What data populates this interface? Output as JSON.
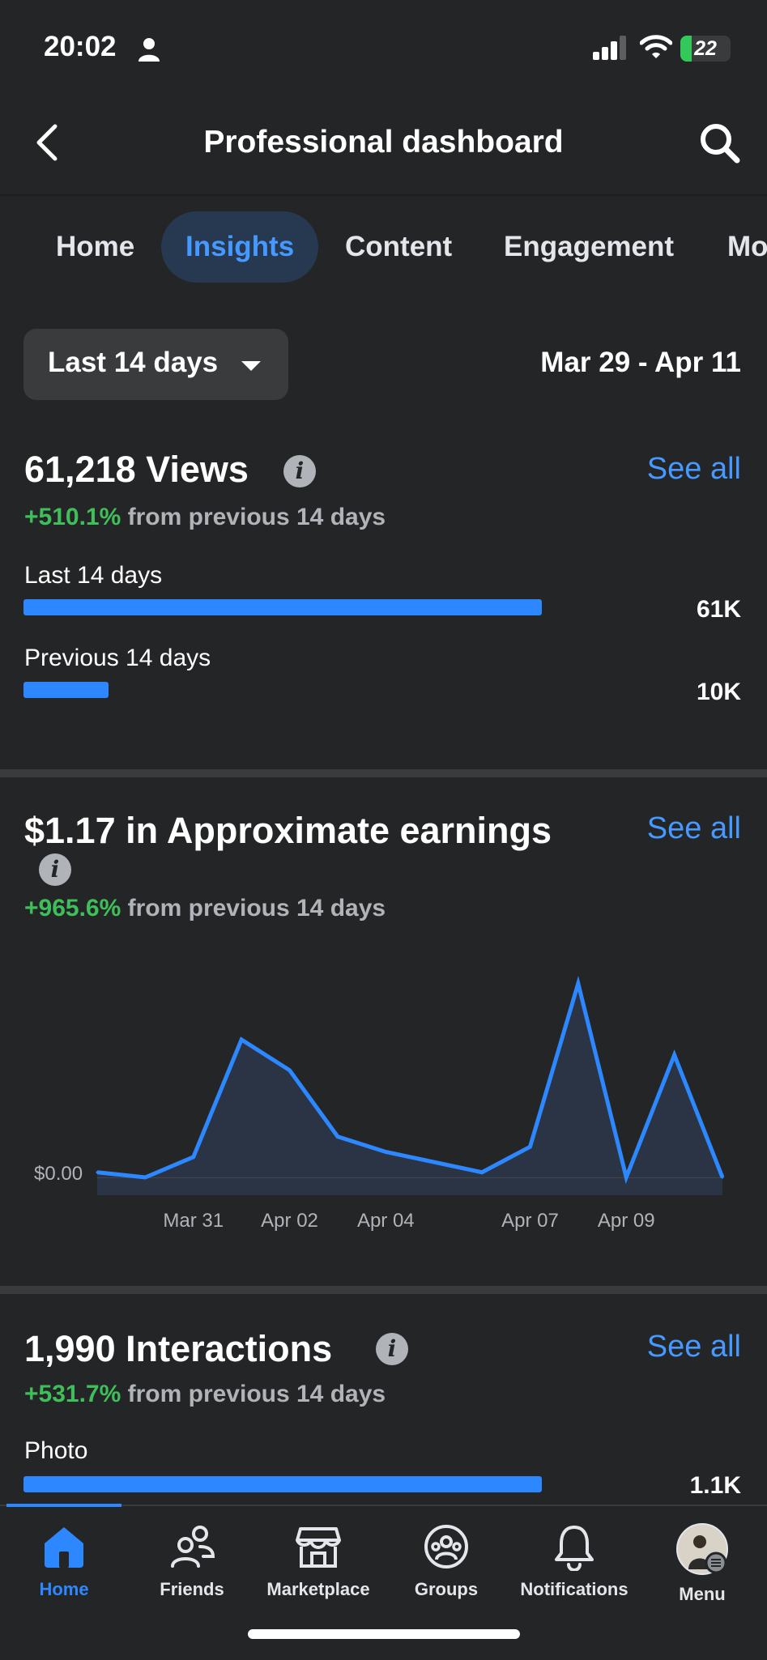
{
  "status_bar": {
    "time": "20:02",
    "battery": "22",
    "battery_level": 0.22
  },
  "header": {
    "title": "Professional dashboard"
  },
  "tabs": [
    {
      "label": "Home",
      "active": false
    },
    {
      "label": "Insights",
      "active": true
    },
    {
      "label": "Content",
      "active": false
    },
    {
      "label": "Engagement",
      "active": false
    },
    {
      "label": "Mo",
      "active": false
    }
  ],
  "filter": {
    "range": "Last 14 days",
    "dates": "Mar 29 - Apr 11"
  },
  "views": {
    "title": "61,218 Views",
    "see_all": "See all",
    "change_pct": "+510.1%",
    "change_text": " from previous 14 days",
    "bars": [
      {
        "label": "Last 14 days",
        "value": "61K",
        "fraction": 1.0
      },
      {
        "label": "Previous 14 days",
        "value": "10K",
        "fraction": 0.164
      }
    ]
  },
  "earnings": {
    "title": "$1.17 in Approximate earnings",
    "see_all": "See all",
    "change_pct": "+965.6%",
    "change_text": " from previous 14 days"
  },
  "chart_data": {
    "type": "area",
    "x": [
      "Mar 29",
      "Mar 30",
      "Mar 31",
      "Apr 01",
      "Apr 02",
      "Apr 03",
      "Apr 04",
      "Apr 05",
      "Apr 06",
      "Apr 07",
      "Apr 08",
      "Apr 09",
      "Apr 10",
      "Apr 11"
    ],
    "values": [
      0.01,
      0.0,
      0.04,
      0.27,
      0.21,
      0.08,
      0.05,
      0.03,
      0.01,
      0.06,
      0.38,
      0.0,
      0.24,
      0.0
    ],
    "x_tick_labels": [
      "Mar 31",
      "Apr 02",
      "Apr 04",
      "Apr 07",
      "Apr 09"
    ],
    "y_tick_labels": [
      "$0.00"
    ],
    "ylim": [
      0,
      0.4
    ],
    "color": "#2d88ff",
    "fill_color": "#2a3444"
  },
  "interactions": {
    "title": "1,990 Interactions",
    "see_all": "See all",
    "change_pct": "+531.7%",
    "change_text": " from previous 14 days",
    "bars": [
      {
        "label": "Photo",
        "value": "1.1K",
        "fraction": 1.0
      }
    ]
  },
  "bottom_nav": [
    {
      "label": "Home",
      "icon": "home-icon",
      "active": true
    },
    {
      "label": "Friends",
      "icon": "friends-icon",
      "active": false
    },
    {
      "label": "Marketplace",
      "icon": "marketplace-icon",
      "active": false
    },
    {
      "label": "Groups",
      "icon": "groups-icon",
      "active": false
    },
    {
      "label": "Notifications",
      "icon": "bell-icon",
      "active": false
    },
    {
      "label": "Menu",
      "icon": "avatar",
      "active": false
    }
  ],
  "colors": {
    "accent": "#2d88ff",
    "positive": "#3fbf5a",
    "background": "#242526"
  }
}
